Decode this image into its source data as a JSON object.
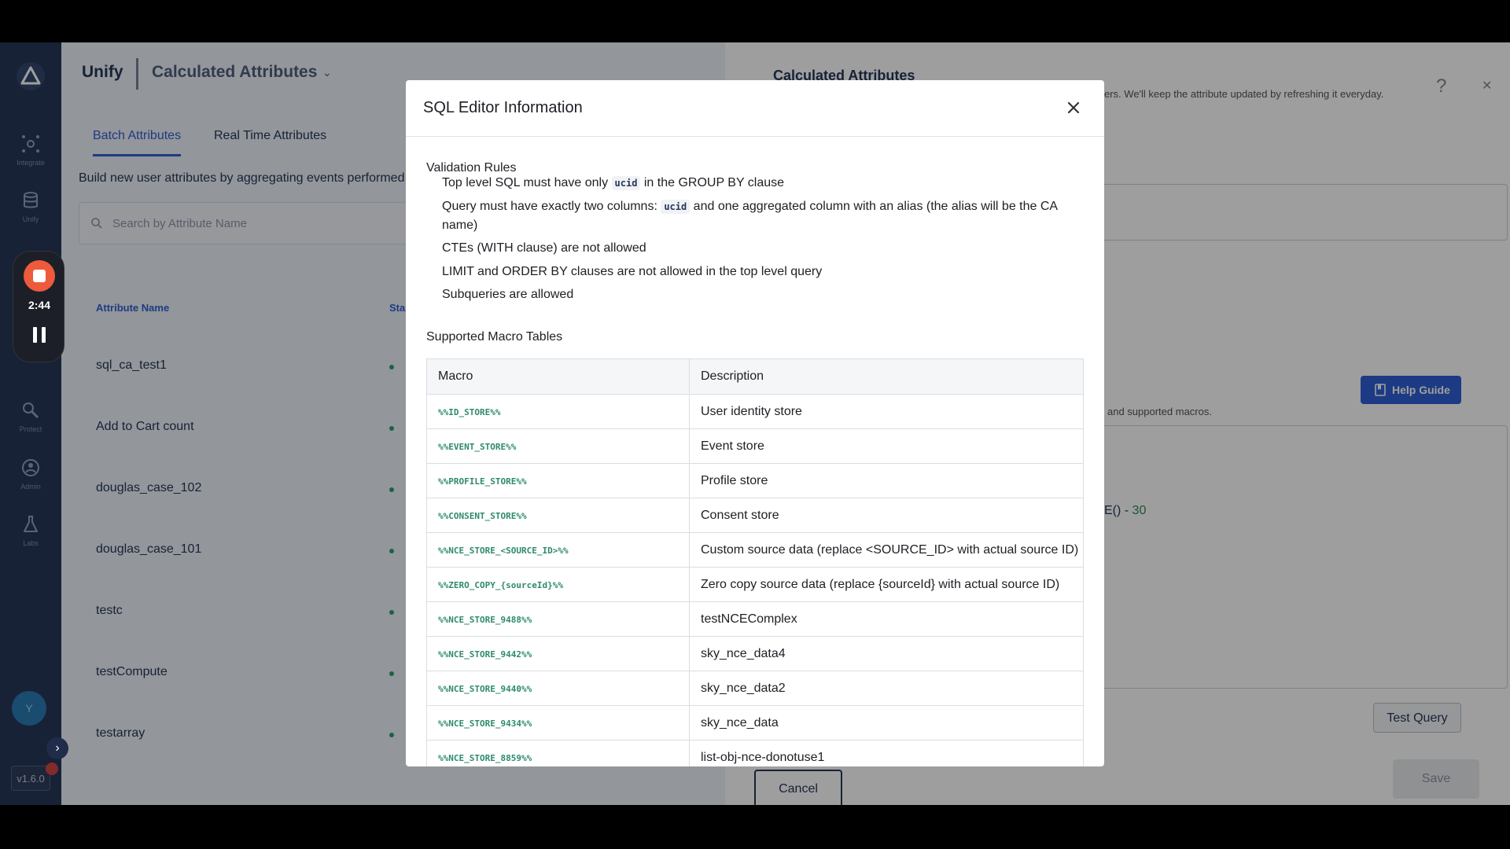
{
  "recorder": {
    "time": "2:44"
  },
  "sidebar": {
    "items": [
      {
        "label": "Integrate",
        "icon": "integrate-icon"
      },
      {
        "label": "Unify",
        "icon": "database-icon"
      },
      {
        "label": "Protect",
        "icon": "protect-icon"
      },
      {
        "label": "Admin",
        "icon": "admin-icon"
      },
      {
        "label": "Labs",
        "icon": "flask-icon"
      }
    ],
    "avatar": "Y",
    "version": "v1.6.0"
  },
  "header": {
    "app": "Unify",
    "page": "Calculated Attributes"
  },
  "tabs": [
    {
      "label": "Batch Attributes"
    },
    {
      "label": "Real Time Attributes"
    }
  ],
  "main": {
    "description": "Build new user attributes by aggregating events performed",
    "search_placeholder": "Search by Attribute Name",
    "columns": [
      "Attribute Name",
      "Sta"
    ],
    "rows": [
      "sql_ca_test1",
      "Add to Cart count",
      "douglas_case_102",
      "douglas_case_101",
      "testc",
      "testCompute",
      "testarray"
    ]
  },
  "right_panel": {
    "title": "Calculated Attributes",
    "subtitle": "ers. We'll keep the attribute updated by refreshing it everyday.",
    "help_guide": "Help Guide",
    "note": "and supported macros.",
    "code_text": "E() - ",
    "code_num": "30",
    "test_query": "Test Query",
    "cancel": "Cancel",
    "save": "Save"
  },
  "modal": {
    "title": "SQL Editor Information",
    "validation_title": "Validation Rules",
    "rules": {
      "r1_pre": "Top level SQL must have only ",
      "r1_code": "ucid",
      "r1_post": " in the GROUP BY clause",
      "r2_pre": "Query must have exactly two columns: ",
      "r2_code": "ucid",
      "r2_post": " and one aggregated column with an alias (the alias will be the CA name)",
      "r3": "CTEs (WITH clause) are not allowed",
      "r4": "LIMIT and ORDER BY clauses are not allowed in the top level query",
      "r5": "Subqueries are allowed"
    },
    "macro_title": "Supported Macro Tables",
    "table_headers": [
      "Macro",
      "Description"
    ],
    "macros": [
      {
        "macro": "%%ID_STORE%%",
        "desc": "User identity store"
      },
      {
        "macro": "%%EVENT_STORE%%",
        "desc": "Event store"
      },
      {
        "macro": "%%PROFILE_STORE%%",
        "desc": "Profile store"
      },
      {
        "macro": "%%CONSENT_STORE%%",
        "desc": "Consent store"
      },
      {
        "macro": "%%NCE_STORE_<SOURCE_ID>%%",
        "desc": "Custom source data (replace <SOURCE_ID> with actual source ID)"
      },
      {
        "macro": "%%ZERO_COPY_{sourceId}%%",
        "desc": "Zero copy source data (replace {sourceId} with actual source ID)"
      },
      {
        "macro": "%%NCE_STORE_9488%%",
        "desc": "testNCEComplex"
      },
      {
        "macro": "%%NCE_STORE_9442%%",
        "desc": "sky_nce_data4"
      },
      {
        "macro": "%%NCE_STORE_9440%%",
        "desc": "sky_nce_data2"
      },
      {
        "macro": "%%NCE_STORE_9434%%",
        "desc": "sky_nce_data"
      },
      {
        "macro": "%%NCE_STORE_8859%%",
        "desc": "list-obj-nce-donotuse1"
      }
    ]
  }
}
